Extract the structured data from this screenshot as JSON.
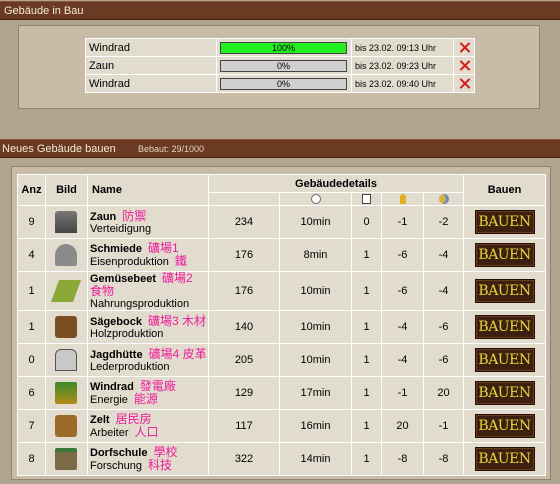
{
  "panel_in_bau": {
    "title": "Gebäude in Bau"
  },
  "in_bau": [
    {
      "name": "Windrad",
      "progress": 100,
      "progress_label": "100%",
      "time": "bis 23.02. 09:13 Uhr"
    },
    {
      "name": "Zaun",
      "progress": 0,
      "progress_label": "0%",
      "time": "bis 23.02. 09:23 Uhr"
    },
    {
      "name": "Windrad",
      "progress": 0,
      "progress_label": "0%",
      "time": "bis 23.02. 09:40 Uhr"
    }
  ],
  "panel_neu": {
    "title": "Neues Gebäude bauen",
    "bebaut": "Bebaut: 29/1000"
  },
  "table": {
    "headers": {
      "anz": "Anz",
      "bild": "Bild",
      "name": "Name",
      "details": "Gebäudedetails",
      "bauen": "Bauen"
    },
    "detail_icons": [
      "clock-icon",
      "document-icon",
      "bulb-icon",
      "moon-icon"
    ],
    "button_label": "BAUEN",
    "rows": [
      {
        "anz": "9",
        "icon": "tower-icon",
        "name": "Zaun",
        "cn": "防禦",
        "desc": "Verteidigung",
        "cn2": "",
        "d1": "234",
        "d2": "10min",
        "d3": "0",
        "d4": "-1",
        "d5": "-2"
      },
      {
        "anz": "4",
        "icon": "smithy-icon",
        "name": "Schmiede",
        "cn": "礦場1",
        "desc": "Eisenproduktion",
        "cn2": "鐵",
        "d1": "176",
        "d2": "8min",
        "d3": "1",
        "d4": "-6",
        "d5": "-4"
      },
      {
        "anz": "1",
        "icon": "garden-icon",
        "name": "Gemüsebeet",
        "cn": "礦場2 食物",
        "desc": "Nahrungsproduktion",
        "cn2": "",
        "d1": "176",
        "d2": "10min",
        "d3": "1",
        "d4": "-6",
        "d5": "-4"
      },
      {
        "anz": "1",
        "icon": "sawmill-icon",
        "name": "Sägebock",
        "cn": "礦場3 木材",
        "desc": "Holzproduktion",
        "cn2": "",
        "d1": "140",
        "d2": "10min",
        "d3": "1",
        "d4": "-4",
        "d5": "-6"
      },
      {
        "anz": "0",
        "icon": "hut-icon",
        "name": "Jagdhütte",
        "cn": "礦場4 皮革",
        "desc": "Lederproduktion",
        "cn2": "",
        "d1": "205",
        "d2": "10min",
        "d3": "1",
        "d4": "-4",
        "d5": "-6"
      },
      {
        "anz": "6",
        "icon": "windmill-icon",
        "name": "Windrad",
        "cn": "發電廠",
        "desc": "Energie",
        "cn2": "能源",
        "d1": "129",
        "d2": "17min",
        "d3": "1",
        "d4": "-1",
        "d5": "20"
      },
      {
        "anz": "7",
        "icon": "tent-icon",
        "name": "Zelt",
        "cn": "居民房",
        "desc": "Arbeiter",
        "cn2": "人口",
        "d1": "117",
        "d2": "16min",
        "d3": "1",
        "d4": "20",
        "d5": "-1"
      },
      {
        "anz": "8",
        "icon": "school-icon",
        "name": "Dorfschule",
        "cn": "學校",
        "desc": "Forschung",
        "cn2": "科技",
        "d1": "322",
        "d2": "14min",
        "d3": "1",
        "d4": "-8",
        "d5": "-8"
      }
    ]
  },
  "colors": {
    "header_bar": "#6b3a22",
    "panel": "#c9bca6",
    "page": "#b1a58f",
    "progress_fill": "#22ee22",
    "delete": "#d31a1a",
    "chinese_note": "#ee1b9a",
    "button_bg": "#3e2010",
    "button_text": "#e4d63a"
  }
}
